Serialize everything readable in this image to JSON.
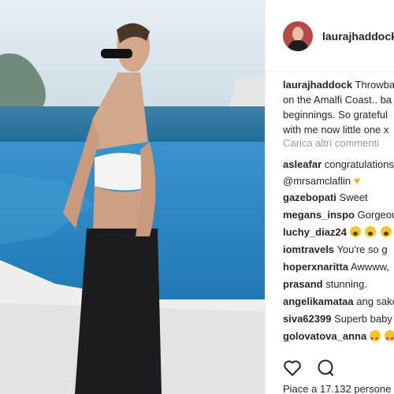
{
  "post": {
    "username": "laurajhaddock",
    "caption_username": "laurajhaddock",
    "caption_lines": [
      "Throwba",
      "on the Amalfi Coast.. ba",
      "beginnings. So grateful",
      "with me now little one x"
    ],
    "load_more": "Carica altri commenti",
    "likes_text": "Piace a 17.132 persone"
  },
  "comments": [
    {
      "user": "asleafar",
      "text": "congratulations"
    },
    {
      "user": "",
      "text": "@mrsamclaflin"
    },
    {
      "user": "gazebopati",
      "text": "Sweet"
    },
    {
      "user": "megans_inspo",
      "text": "Gorgeou"
    },
    {
      "user": "luchy_diaz24",
      "text": ""
    },
    {
      "user": "iomtravels",
      "text": "You're so g"
    },
    {
      "user": "hoperxnaritta",
      "text": "Awwww,"
    },
    {
      "user": "prasand",
      "text": "stunning."
    },
    {
      "user": "angelikamataa",
      "text": "ang sakc"
    },
    {
      "user": "siva62399",
      "text": "Superb baby"
    },
    {
      "user": "golovatova_anna",
      "text": ""
    }
  ],
  "icons": {
    "like": "heart-outline-icon",
    "comment": "comment-bubble-icon"
  },
  "colors": {
    "text": "#262626",
    "muted": "#999999",
    "sea": "#1f6d9b",
    "pool": "#2a86c2"
  }
}
